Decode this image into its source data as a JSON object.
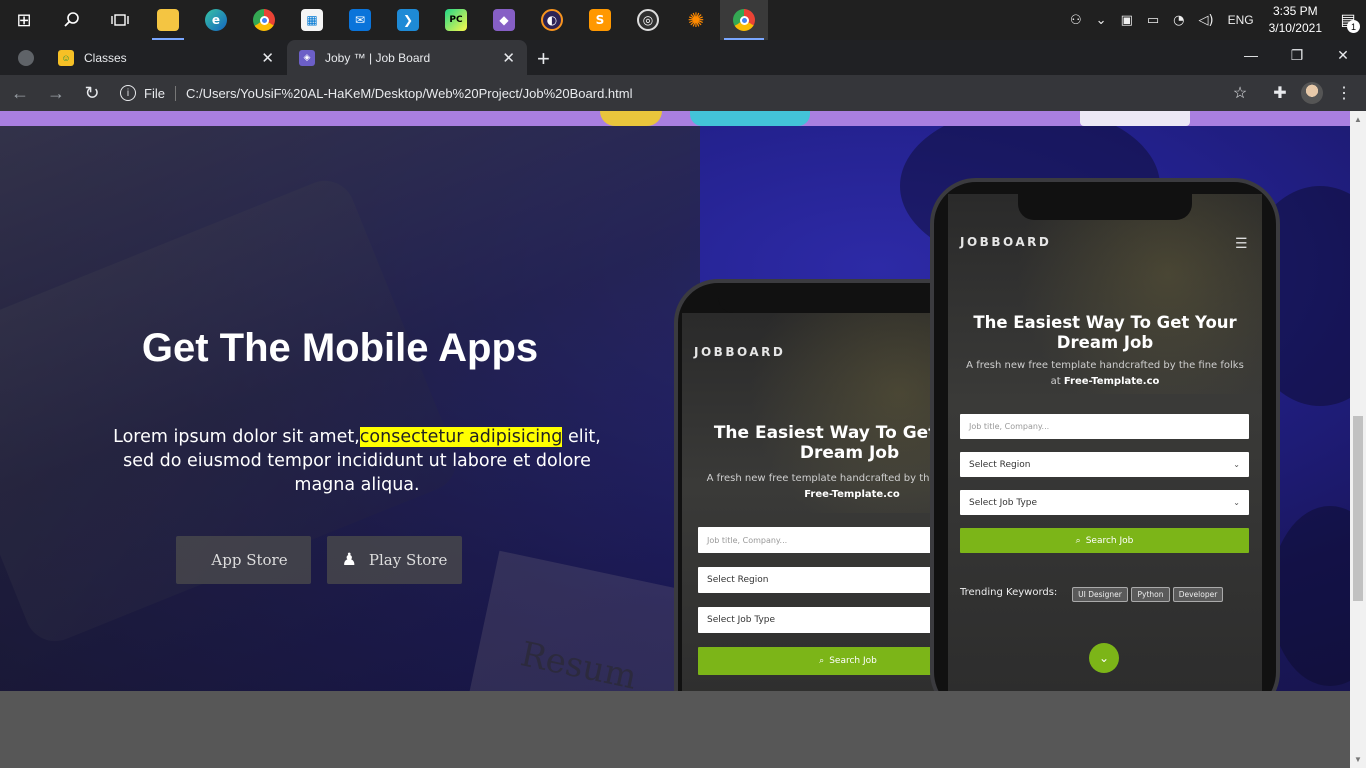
{
  "taskbar": {
    "apps": [
      {
        "name": "start",
        "glyph": "⊞"
      },
      {
        "name": "search",
        "glyph": "⌕"
      },
      {
        "name": "task-view",
        "glyph": "❐"
      },
      {
        "name": "file-explorer",
        "glyph": "▬"
      },
      {
        "name": "edge",
        "glyph": "e"
      },
      {
        "name": "chrome",
        "glyph": "●"
      },
      {
        "name": "store",
        "glyph": "▦"
      },
      {
        "name": "mail",
        "glyph": "✉"
      },
      {
        "name": "vscode",
        "glyph": "❯"
      },
      {
        "name": "pycharm",
        "glyph": "PC"
      },
      {
        "name": "visual-studio",
        "glyph": "◆"
      },
      {
        "name": "eclipse",
        "glyph": "◐"
      },
      {
        "name": "sublime",
        "glyph": "S"
      },
      {
        "name": "obs",
        "glyph": "◎"
      },
      {
        "name": "app-sun",
        "glyph": "✺"
      },
      {
        "name": "chrome-active",
        "glyph": "●"
      }
    ],
    "tray": {
      "language": "ENG",
      "time": "3:35 PM",
      "date": "3/10/2021",
      "notifications": "1"
    }
  },
  "browser": {
    "tabs": [
      {
        "title": "Classes",
        "active": false
      },
      {
        "title": "Joby ™ | Job Board",
        "active": true
      }
    ],
    "new_tab": "+",
    "url_scheme": "File",
    "url": "C:/Users/YoUsiF%20AL-HaKeM/Desktop/Web%20Project/Job%20Board.html"
  },
  "hero": {
    "title": "Get The Mobile Apps",
    "text_before": "Lorem ipsum dolor sit amet,",
    "text_highlight": "consectetur adipisicing",
    "text_after": " elit, sed do eiusmod tempor incididunt ut labore et dolore magna aliqua.",
    "app_store": "App Store",
    "play_store": "Play Store",
    "paper_text": "Resum"
  },
  "phone_back": {
    "brand": "JOBBOARD",
    "heading": "The Easiest Way To Get Your Dream Job",
    "sub": "A fresh new free template handcrafted by the fine folks at",
    "sub_bold": "Free-Template.co",
    "input_placeholder": "Job title, Company...",
    "select_region": "Select Region",
    "select_type": "Select Job Type",
    "search_btn": "Search Job"
  },
  "phone_front": {
    "brand": "JOBBOARD",
    "heading": "The Easiest Way To Get Your Dream Job",
    "sub": "A fresh new free template handcrafted by the fine folks at",
    "sub_bold": "Free-Template.co",
    "input_placeholder": "Job title, Company...",
    "select_region": "Select Region",
    "select_type": "Select Job Type",
    "search_btn": "Search Job",
    "trending_label": "Trending Keywords:",
    "chips": [
      "UI Designer",
      "Python",
      "Developer"
    ]
  },
  "colors": {
    "accent_green": "#7cb518",
    "highlight": "#ffff00",
    "hero_blue": "#22208a",
    "strip_purple": "#a97fe0"
  }
}
